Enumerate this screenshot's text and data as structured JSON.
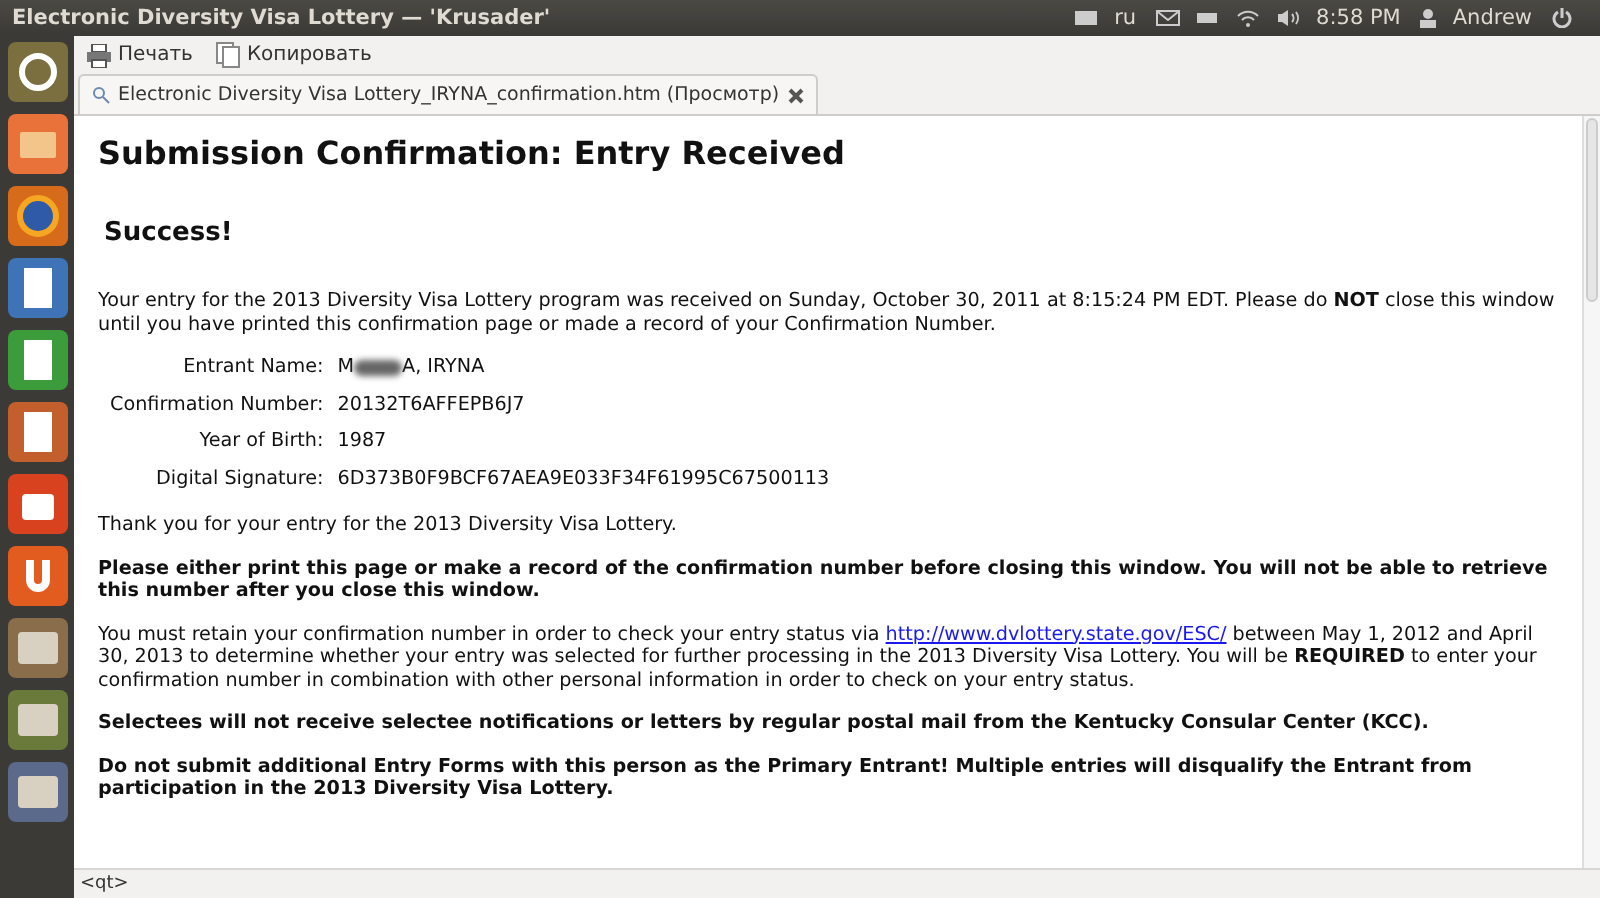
{
  "top_panel": {
    "title": "Electronic Diversity Visa Lottery — 'Krusader'",
    "keyboard_layout": "ru",
    "time": "8:58 PM",
    "user": "Andrew"
  },
  "toolbar": {
    "buttons": [
      {
        "kind": "print",
        "label": "Печать"
      },
      {
        "kind": "copy",
        "label": "Копировать"
      }
    ]
  },
  "tabs": [
    {
      "label": "Electronic Diversity Visa Lottery_IRYNA_confirmation.htm (Просмотр)",
      "selected": true
    }
  ],
  "page": {
    "heading": "Submission Confirmation: Entry Received",
    "success": "Success!",
    "intro": "Your entry for the 2013 Diversity Visa Lottery program was received on Sunday, October 30, 2011 at 8:15:24 PM EDT. Please do **NOT** close this window until you have printed this confirmation page or made a record of your Confirmation Number.",
    "fields": [
      {
        "label": "Entrant Name:",
        "value_start": "M",
        "value_end": "A, IRYNA",
        "blurred": true
      },
      {
        "label": "Confirmation Number:",
        "value_start": "20132T6AFFEPB6J7",
        "blurred": false
      },
      {
        "label": "Year of Birth:",
        "value_start": "1987",
        "blurred": false
      },
      {
        "label": "Digital Signature:",
        "value_start": "6D373B0F9BCF67AEA9E033F34F61995C67500113",
        "blurred": false
      }
    ],
    "paragraphs": [
      {
        "kind": "plain",
        "text": "Thank you for your entry for the 2013 Diversity Visa Lottery."
      },
      {
        "kind": "bold",
        "text": "Please either print this page or make a record of the confirmation number before closing this window. You will not be able to retrieve this number after you close this window."
      },
      {
        "kind": "link",
        "before": "You must retain your confirmation number in order to check your entry status via",
        "link": "http://www.dvlottery.state.gov/ESC/",
        "after": "between May 1, 2012 and April 30, 2013 to determine whether your entry was selected for further processing in the 2013 Diversity Visa Lottery. You will be **REQUIRED** to enter your confirmation number in combination with other personal information in order to check on your entry status."
      },
      {
        "kind": "bold",
        "text": "Selectees will not receive selectee notifications or letters by regular postal mail from the Kentucky Consular Center (KCC)."
      },
      {
        "kind": "bold",
        "text": "Do not submit additional Entry Forms with this person as the Primary Entrant! Multiple entries will disqualify the Entrant from participation in the 2013 Diversity Visa Lottery."
      }
    ]
  },
  "status_bar": "<qt>"
}
